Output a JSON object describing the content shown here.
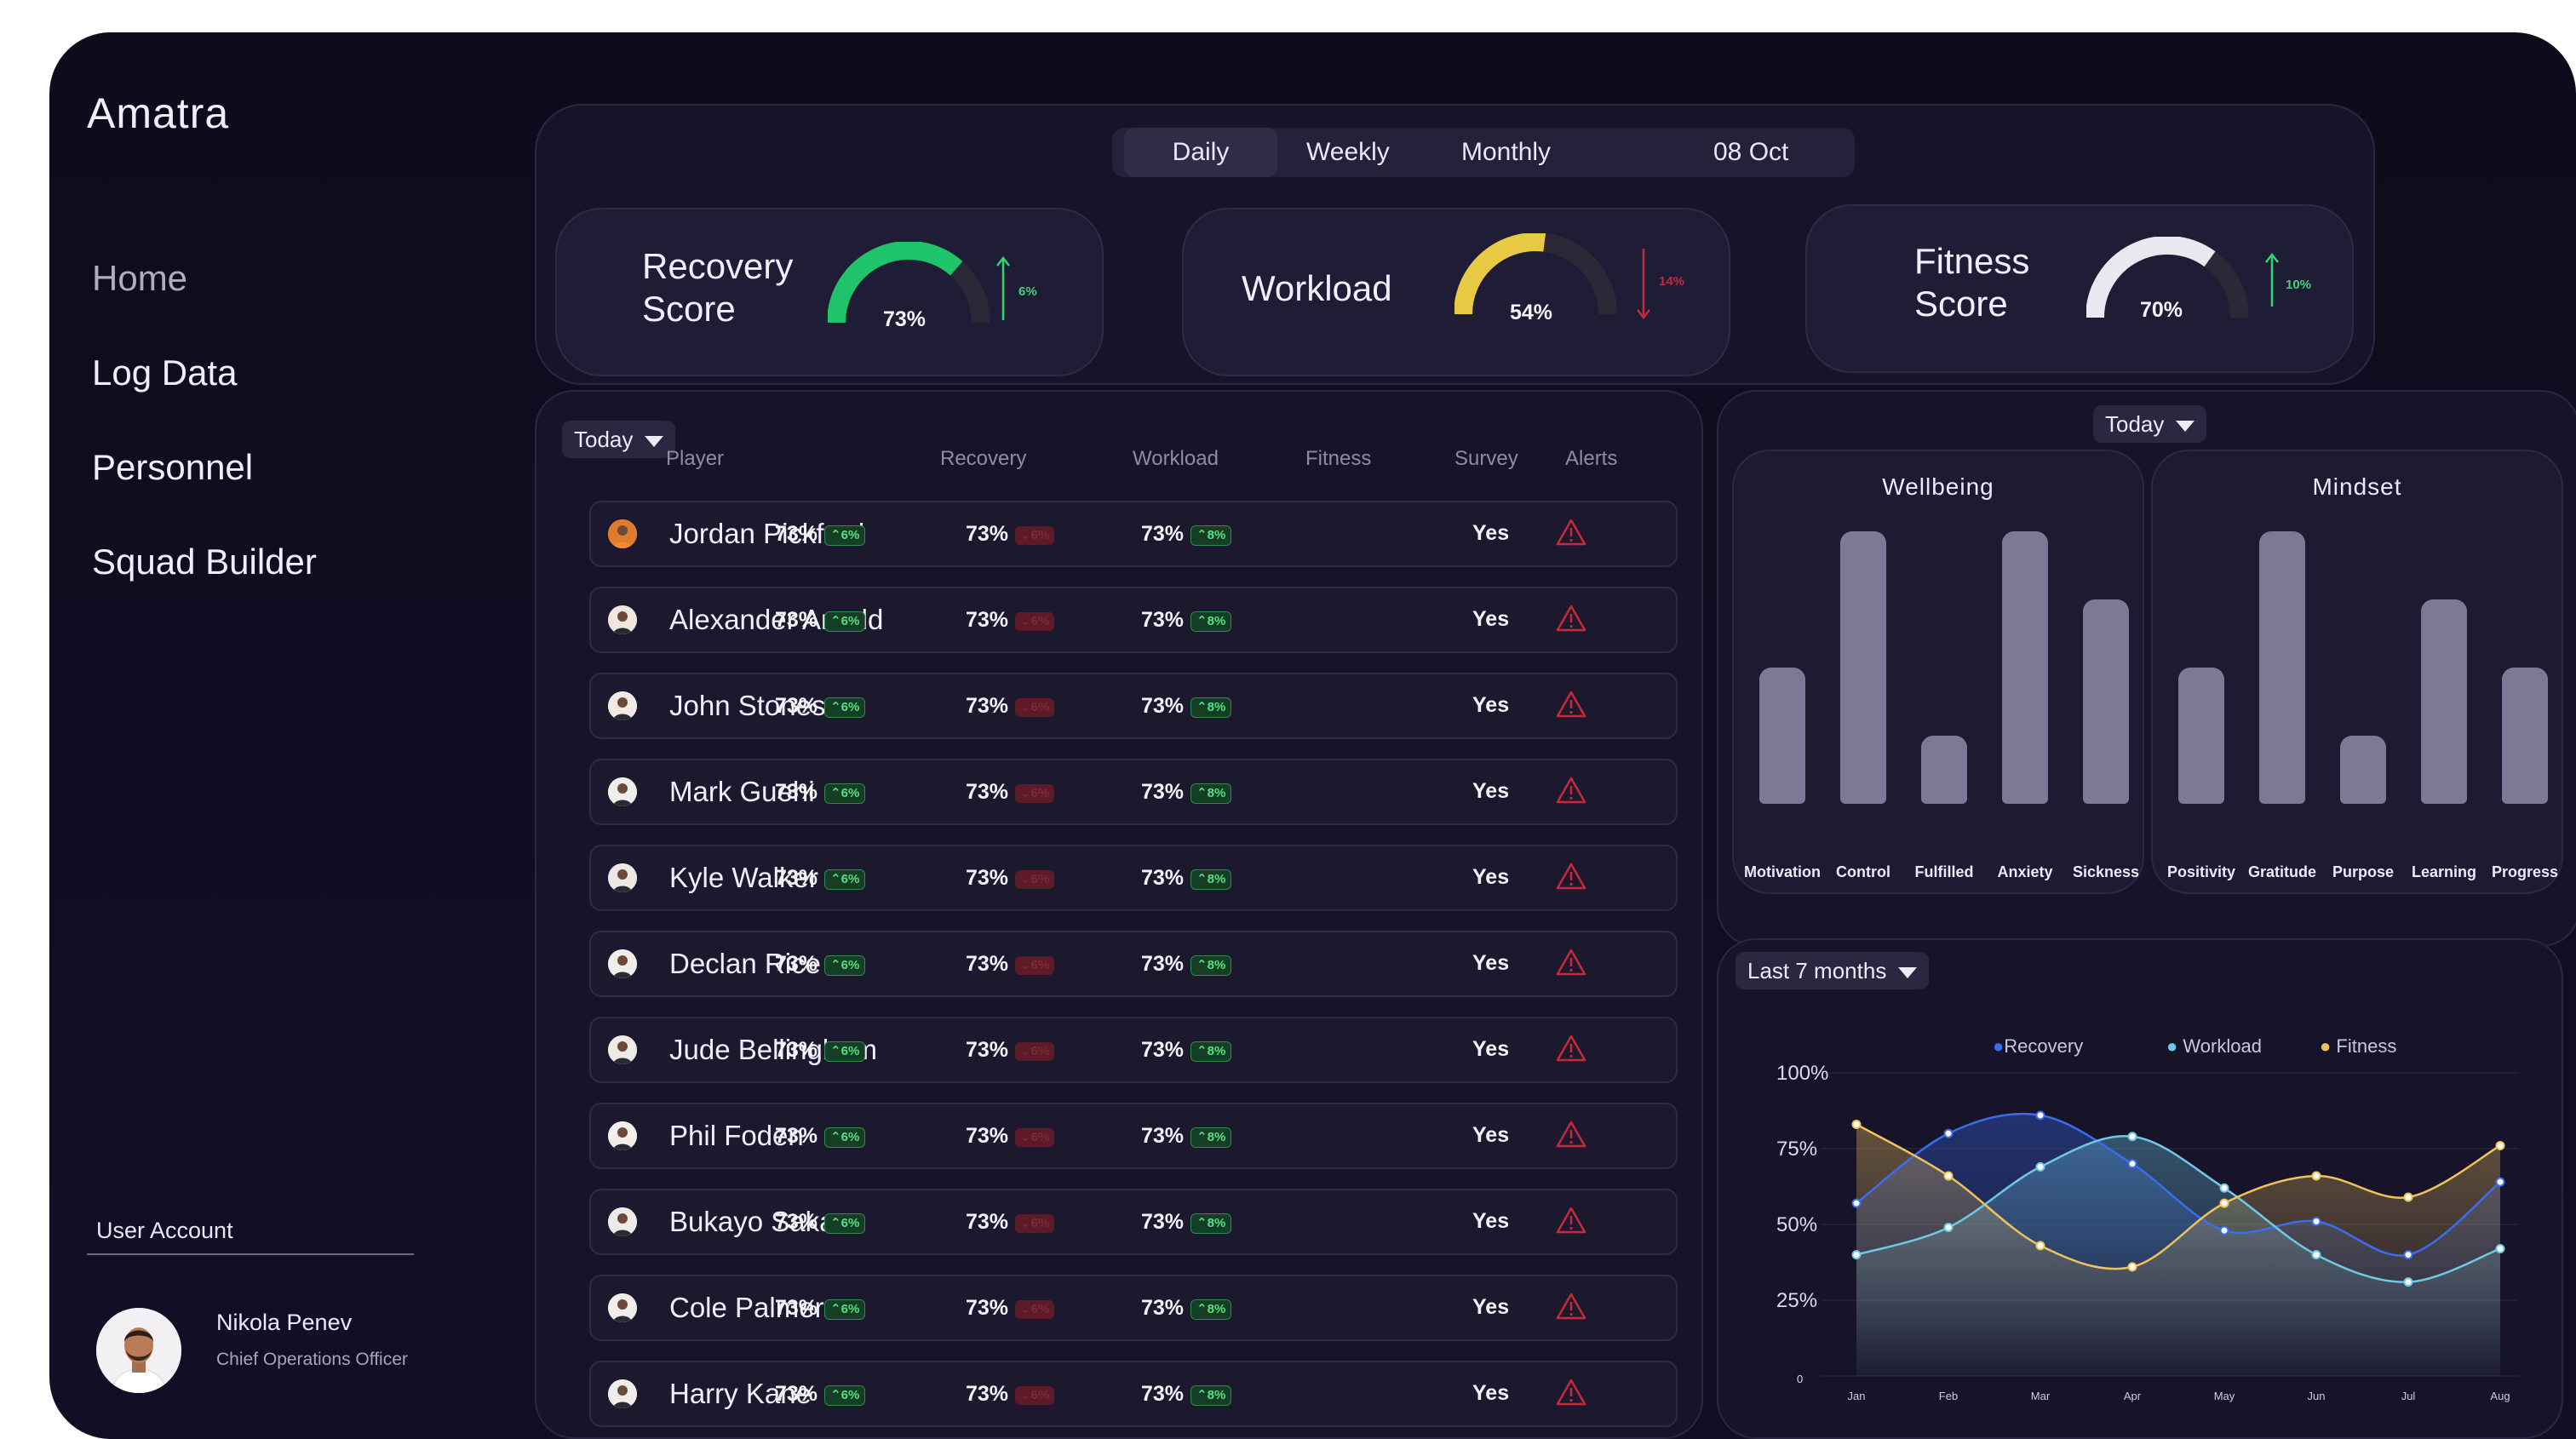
{
  "app": {
    "brand": "Amatra"
  },
  "nav": {
    "items": [
      "Home",
      "Log Data",
      "Personnel",
      "Squad Builder"
    ]
  },
  "user": {
    "section_label": "User Account",
    "name": "Nikola Penev",
    "role": "Chief Operations Officer"
  },
  "period": {
    "tabs": [
      "Daily",
      "Weekly",
      "Monthly"
    ],
    "active": "Daily",
    "date": "08 Oct"
  },
  "metrics": [
    {
      "title_line1": "Recovery",
      "title_line2": "Score",
      "value": "73%",
      "fraction": 0.73,
      "trend": "6%",
      "direction": "up",
      "color": "#1fc36a"
    },
    {
      "title_line1": "Workload",
      "title_line2": "",
      "value": "54%",
      "fraction": 0.54,
      "trend": "14%",
      "direction": "down",
      "color": "#e8c944"
    },
    {
      "title_line1": "Fitness",
      "title_line2": "Score",
      "value": "70%",
      "fraction": 0.7,
      "trend": "10%",
      "direction": "up",
      "color": "#e8e8ee"
    }
  ],
  "table": {
    "filter": "Today",
    "headers": {
      "player": "Player",
      "recovery": "Recovery",
      "workload": "Workload",
      "fitness": "Fitness",
      "survey": "Survey",
      "alerts": "Alerts"
    },
    "rows": [
      {
        "player": "Jordan Pickford",
        "recovery": "73%",
        "recovery_delta": "6%",
        "workload": "73%",
        "workload_delta": "6%",
        "fitness": "73%",
        "fitness_delta": "8%",
        "survey": "Yes"
      },
      {
        "player": "Alexander Arnold",
        "recovery": "73%",
        "recovery_delta": "6%",
        "workload": "73%",
        "workload_delta": "6%",
        "fitness": "73%",
        "fitness_delta": "8%",
        "survey": "Yes"
      },
      {
        "player": "John Stones",
        "recovery": "73%",
        "recovery_delta": "6%",
        "workload": "73%",
        "workload_delta": "6%",
        "fitness": "73%",
        "fitness_delta": "8%",
        "survey": "Yes"
      },
      {
        "player": "Mark Guehi",
        "recovery": "73%",
        "recovery_delta": "6%",
        "workload": "73%",
        "workload_delta": "6%",
        "fitness": "73%",
        "fitness_delta": "8%",
        "survey": "Yes"
      },
      {
        "player": "Kyle Walker",
        "recovery": "73%",
        "recovery_delta": "6%",
        "workload": "73%",
        "workload_delta": "6%",
        "fitness": "73%",
        "fitness_delta": "8%",
        "survey": "Yes"
      },
      {
        "player": "Declan Rice",
        "recovery": "73%",
        "recovery_delta": "6%",
        "workload": "73%",
        "workload_delta": "6%",
        "fitness": "73%",
        "fitness_delta": "8%",
        "survey": "Yes"
      },
      {
        "player": "Jude Bellingham",
        "recovery": "73%",
        "recovery_delta": "6%",
        "workload": "73%",
        "workload_delta": "6%",
        "fitness": "73%",
        "fitness_delta": "8%",
        "survey": "Yes"
      },
      {
        "player": "Phil Foden",
        "recovery": "73%",
        "recovery_delta": "6%",
        "workload": "73%",
        "workload_delta": "6%",
        "fitness": "73%",
        "fitness_delta": "8%",
        "survey": "Yes"
      },
      {
        "player": "Bukayo Saka",
        "recovery": "73%",
        "recovery_delta": "6%",
        "workload": "73%",
        "workload_delta": "6%",
        "fitness": "73%",
        "fitness_delta": "8%",
        "survey": "Yes"
      },
      {
        "player": "Cole Palmer",
        "recovery": "73%",
        "recovery_delta": "6%",
        "workload": "73%",
        "workload_delta": "6%",
        "fitness": "73%",
        "fitness_delta": "8%",
        "survey": "Yes"
      },
      {
        "player": "Harry Kane",
        "recovery": "73%",
        "recovery_delta": "6%",
        "workload": "73%",
        "workload_delta": "6%",
        "fitness": "73%",
        "fitness_delta": "8%",
        "survey": "Yes"
      }
    ]
  },
  "survey_filter": "Today",
  "chart_data": [
    {
      "type": "bar",
      "title": "Wellbeing",
      "categories": [
        "Motivation",
        "Control",
        "Fulfilled",
        "Anxiety",
        "Sickness"
      ],
      "values": [
        50,
        100,
        25,
        100,
        75
      ],
      "ylim": [
        0,
        100
      ]
    },
    {
      "type": "bar",
      "title": "Mindset",
      "categories": [
        "Positivity",
        "Gratitude",
        "Purpose",
        "Learning",
        "Progress"
      ],
      "values": [
        50,
        100,
        25,
        75,
        50
      ],
      "ylim": [
        0,
        100
      ]
    },
    {
      "type": "area",
      "filter": "Last 7 months",
      "categories": [
        "Jan",
        "Feb",
        "Mar",
        "Apr",
        "May",
        "Jun",
        "Jul",
        "Aug"
      ],
      "y_ticks": [
        "0",
        "25%",
        "50%",
        "75%",
        "100%"
      ],
      "ylim": [
        0,
        100
      ],
      "legend": "top-center",
      "series": [
        {
          "name": "Recovery",
          "color": "#3a6df0",
          "values": [
            57,
            80,
            86,
            70,
            48,
            51,
            40,
            64
          ]
        },
        {
          "name": "Workload",
          "color": "#6ec9e6",
          "values": [
            40,
            49,
            69,
            79,
            62,
            40,
            31,
            42
          ]
        },
        {
          "name": "Fitness",
          "color": "#f0c35a",
          "values": [
            83,
            66,
            43,
            36,
            57,
            66,
            59,
            76
          ]
        }
      ]
    }
  ]
}
